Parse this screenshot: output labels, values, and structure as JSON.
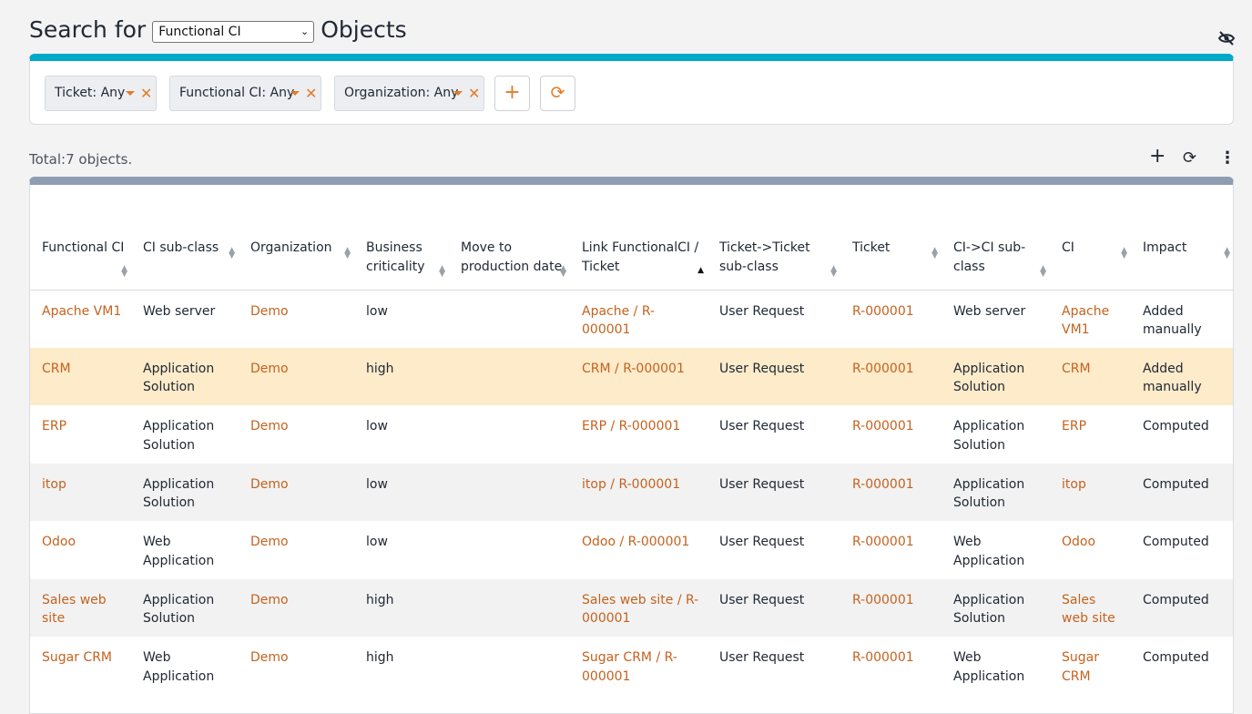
{
  "search": {
    "prefix": "Search for",
    "class_value": "Functional CI",
    "suffix": "Objects"
  },
  "criteria": [
    {
      "label": "Ticket: Any"
    },
    {
      "label": "Functional CI: Any"
    },
    {
      "label": "Organization: Any"
    }
  ],
  "list": {
    "total_text": "Total:7 objects."
  },
  "colors": {
    "accent": "#00a9c7",
    "link": "#c4621e",
    "action": "#e37b27",
    "highlight_row": "#fdebca"
  },
  "table": {
    "columns": [
      "Functional CI",
      "CI sub-class",
      "Organization",
      "Business criticality",
      "Move to production date",
      "Link FunctionalCI / Ticket",
      "Ticket->Ticket sub-class",
      "Ticket",
      "CI->CI sub-class",
      "CI",
      "Impact"
    ],
    "rows": [
      [
        "Apache VM1",
        "Web server",
        "Demo",
        "low",
        "",
        "Apache / R-000001",
        "User Request",
        "R-000001",
        "Web server",
        "Apache VM1",
        "Added manually"
      ],
      [
        "CRM",
        "Application Solution",
        "Demo",
        "high",
        "",
        "CRM / R-000001",
        "User Request",
        "R-000001",
        "Application Solution",
        "CRM",
        "Added manually"
      ],
      [
        "ERP",
        "Application Solution",
        "Demo",
        "low",
        "",
        "ERP / R-000001",
        "User Request",
        "R-000001",
        "Application Solution",
        "ERP",
        "Computed"
      ],
      [
        "itop",
        "Application Solution",
        "Demo",
        "low",
        "",
        "itop / R-000001",
        "User Request",
        "R-000001",
        "Application Solution",
        "itop",
        "Computed"
      ],
      [
        "Odoo",
        "Web Application",
        "Demo",
        "low",
        "",
        "Odoo / R-000001",
        "User Request",
        "R-000001",
        "Web Application",
        "Odoo",
        "Computed"
      ],
      [
        "Sales web site",
        "Application Solution",
        "Demo",
        "high",
        "",
        "Sales web site / R-000001",
        "User Request",
        "R-000001",
        "Application Solution",
        "Sales web site",
        "Computed"
      ],
      [
        "Sugar CRM",
        "Web Application",
        "Demo",
        "high",
        "",
        "Sugar CRM / R-000001",
        "User Request",
        "R-000001",
        "Web Application",
        "Sugar CRM",
        "Computed"
      ]
    ]
  }
}
